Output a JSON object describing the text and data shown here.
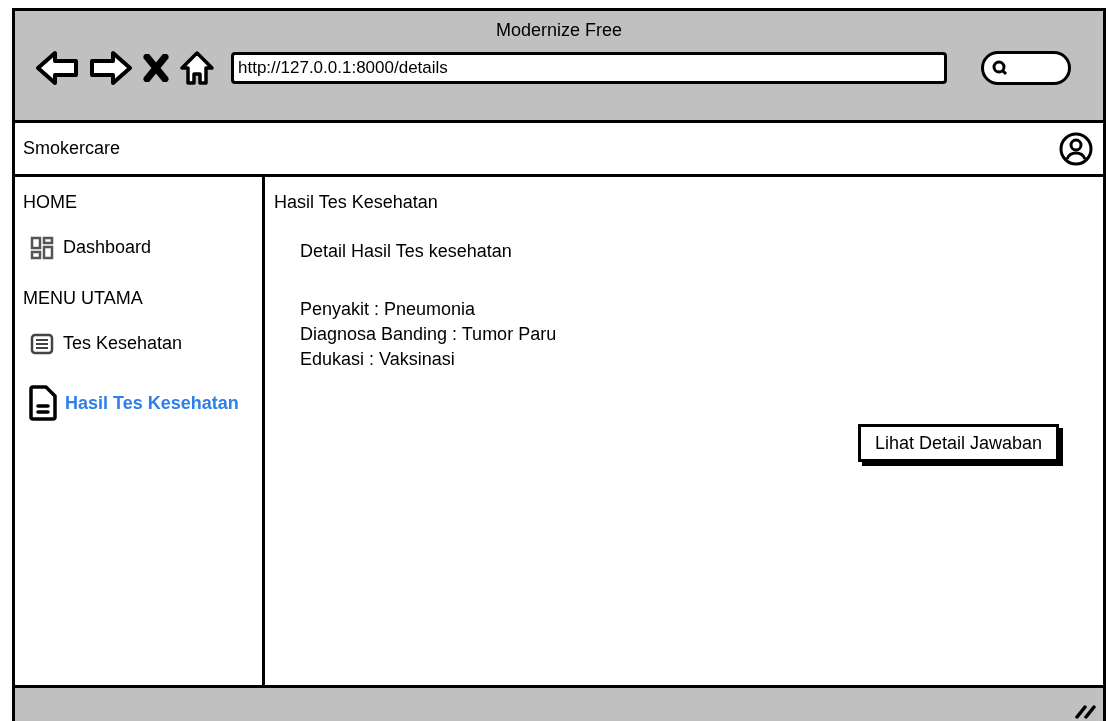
{
  "window": {
    "title": "Modernize Free"
  },
  "address_bar": {
    "url": "http://127.0.0.1:8000/details"
  },
  "app_bar": {
    "title": "Smokercare"
  },
  "sidebar": {
    "items": [
      {
        "kind": "heading",
        "label": "HOME"
      },
      {
        "kind": "link",
        "label": "Dashboard",
        "selected": false
      },
      {
        "kind": "heading",
        "label": "MENU UTAMA"
      },
      {
        "kind": "link",
        "label": "Tes Kesehatan",
        "selected": false
      },
      {
        "kind": "link",
        "label": "Hasil Tes Kesehatan",
        "selected": true
      }
    ]
  },
  "content": {
    "title": "Hasil Tes Kesehatan",
    "subtitle": "Detail Hasil Tes kesehatan",
    "details": [
      "Penyakit : Pneumonia",
      "Diagnosa Banding : Tumor Paru",
      "Edukasi : Vaksinasi"
    ],
    "button": "Lihat Detail Jawaban"
  }
}
